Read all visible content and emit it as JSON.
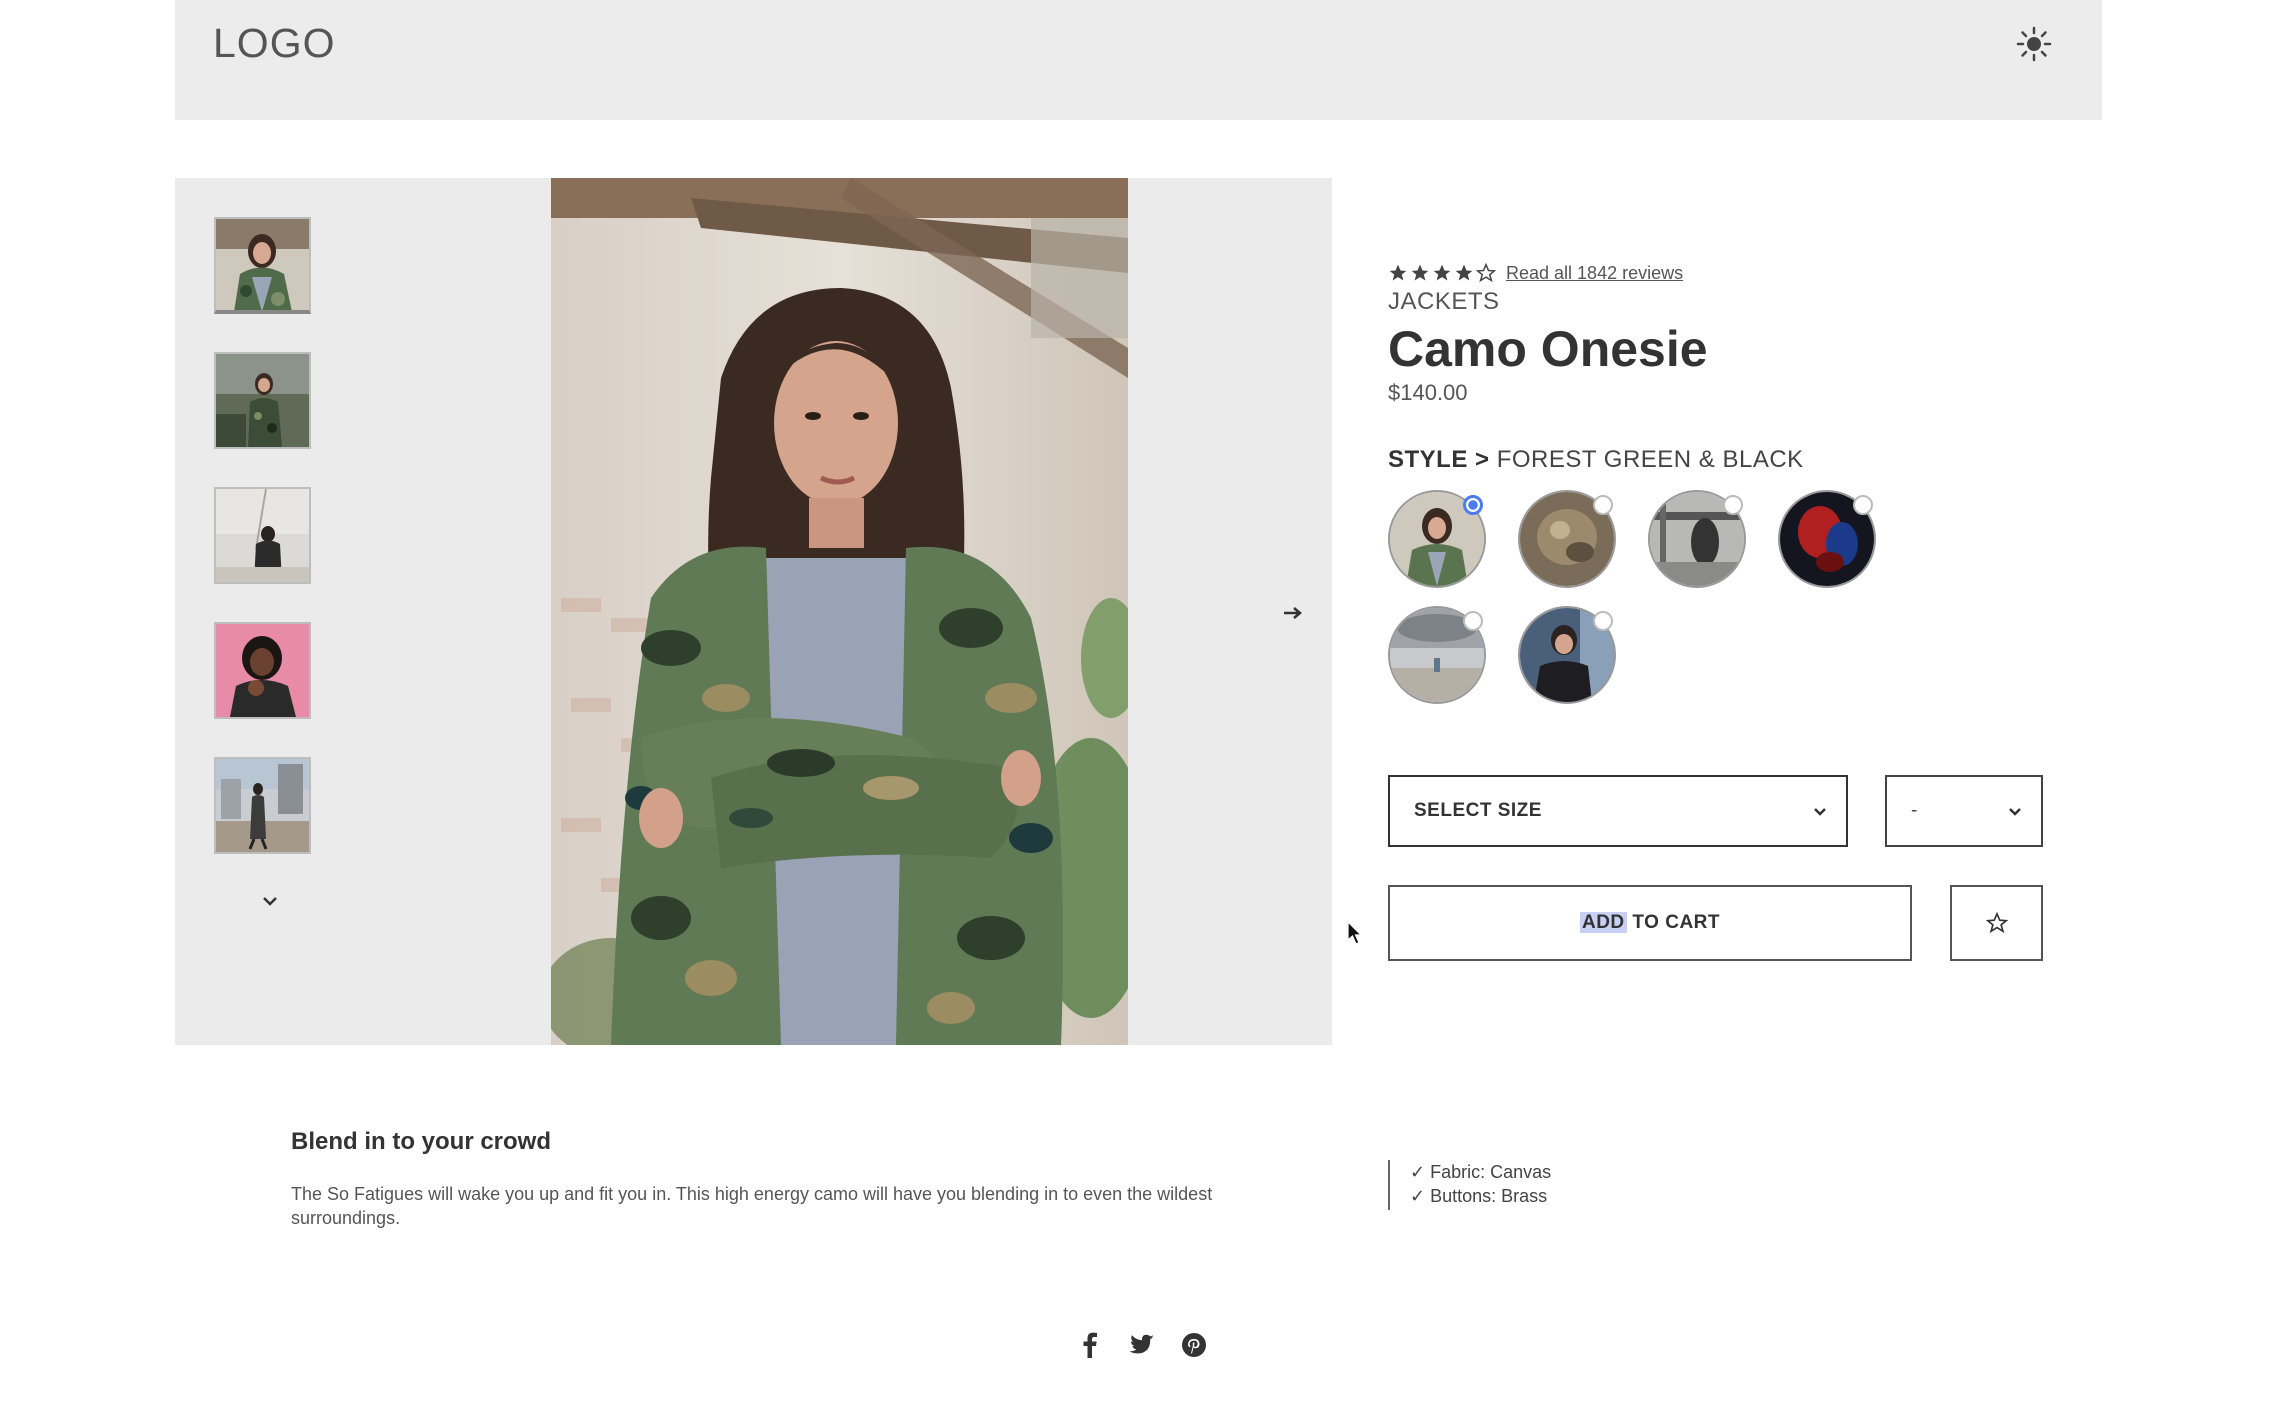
{
  "header": {
    "logo": "LOGO",
    "theme_toggle_icon": "sun-icon"
  },
  "gallery": {
    "thumbnails": [
      {
        "alt": "woman in camo jacket",
        "icon": "thumbnail-image"
      },
      {
        "alt": "woman in camo jacket outdoors",
        "icon": "thumbnail-image"
      },
      {
        "alt": "person in black jacket",
        "icon": "thumbnail-image"
      },
      {
        "alt": "woman on pink background",
        "icon": "thumbnail-image"
      },
      {
        "alt": "person walking on street",
        "icon": "thumbnail-image"
      }
    ],
    "thumbs_down_icon": "chevron-down-icon",
    "next_icon": "arrow-right-icon"
  },
  "product": {
    "rating": 4,
    "rating_max": 5,
    "reviews_link": "Read all 1842 reviews",
    "category": "JACKETS",
    "title": "Camo Onesie",
    "price": "$140.00"
  },
  "style": {
    "label": "STYLE >",
    "selected_name": "FOREST GREEN & BLACK",
    "selected_index": 0
  },
  "size_select": {
    "label": "SELECT SIZE",
    "icon": "chevron-down-icon"
  },
  "qty_select": {
    "label": "-",
    "icon": "chevron-down-icon"
  },
  "cart": {
    "add_highlight": "ADD",
    "add_rest": " TO CART",
    "fav_icon": "star-outline-icon"
  },
  "description": {
    "title": "Blend in to your crowd",
    "body": "The So Fatigues will wake you up and fit you in. This high energy camo will have you blending in to even the wildest surroundings."
  },
  "features": [
    "✓  Fabric: Canvas",
    "✓  Buttons: Brass"
  ],
  "social": [
    "facebook-icon",
    "twitter-icon",
    "pinterest-icon"
  ],
  "colors": {
    "header_bg": "#ececec",
    "gallery_bg": "#ebebeb",
    "selected_swatch": "#4a7cf0",
    "highlight": "#c8d1f4"
  }
}
